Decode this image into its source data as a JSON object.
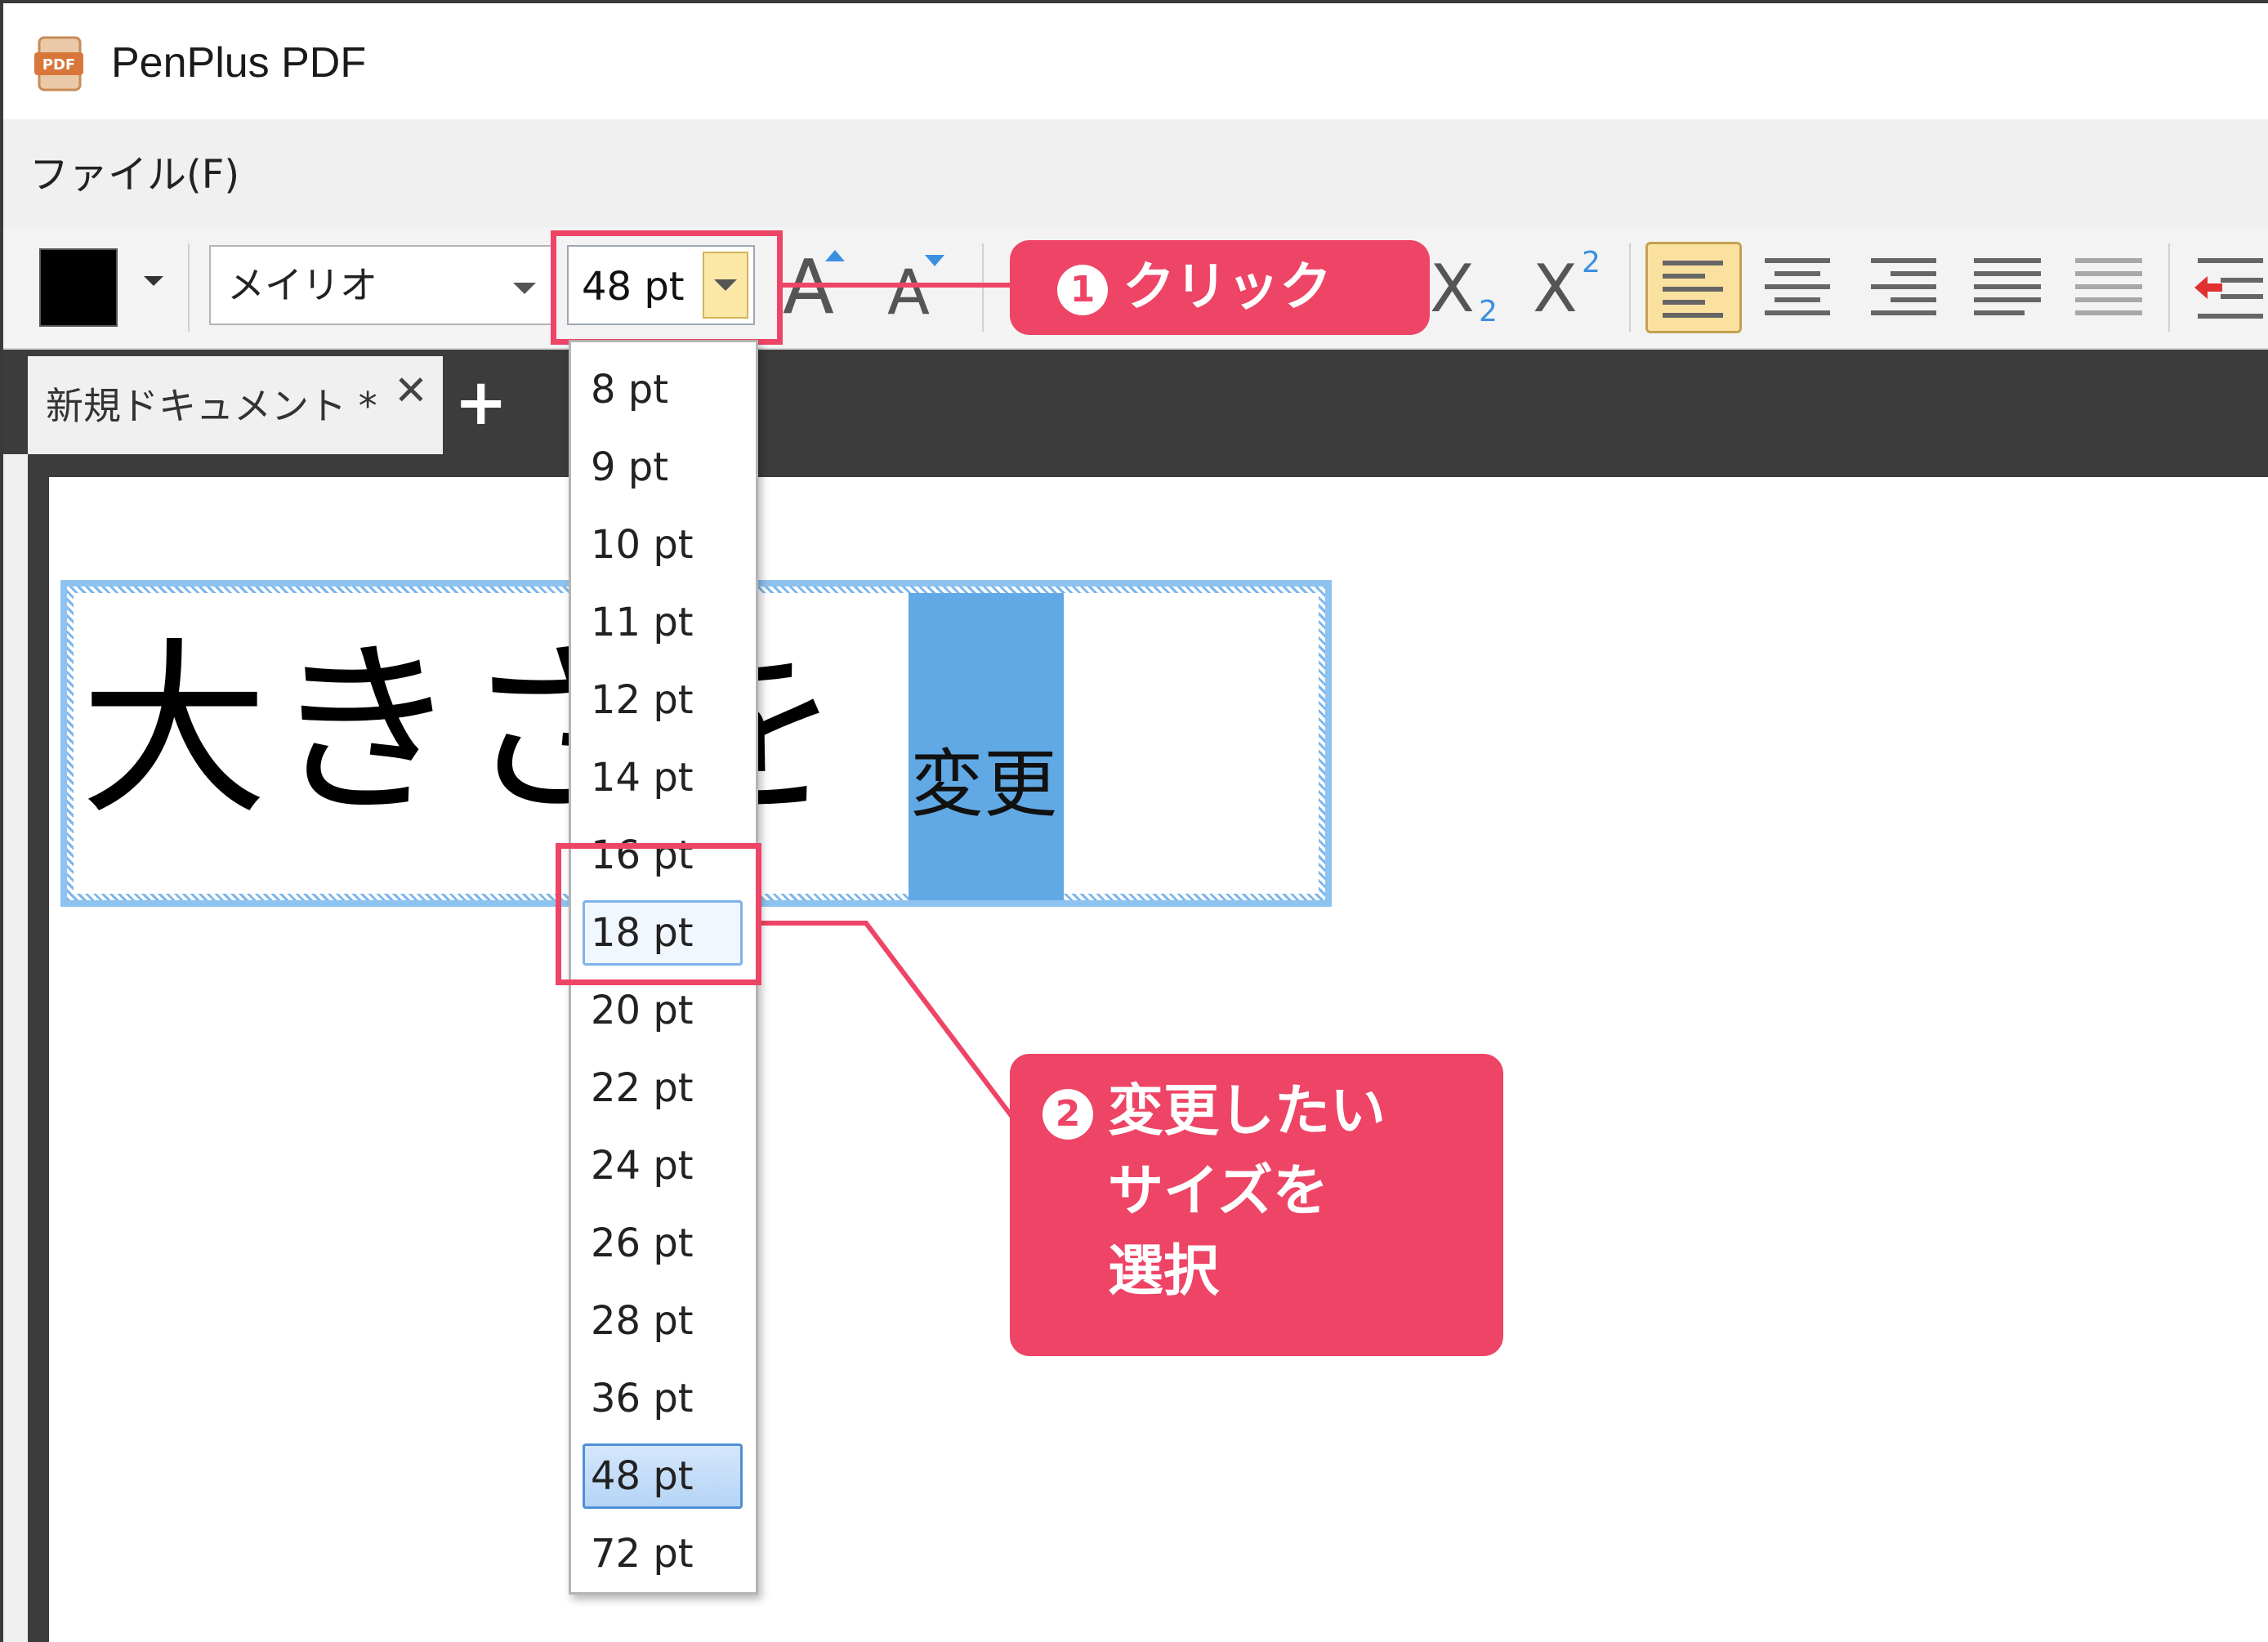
{
  "window": {
    "title": "PenPlus PDF",
    "icon": "pdf-icon",
    "icon_label": "PDF"
  },
  "menu": {
    "file": "ファイル(F)"
  },
  "toolbar": {
    "font_name": "メイリオ",
    "font_size": "48 pt",
    "subscript_label": "X",
    "subscript_digit": "2",
    "superscript_label": "X",
    "superscript_digit": "2",
    "grow_font_label": "A",
    "shrink_font_label": "A"
  },
  "tabs": {
    "active_label": "新規ドキュメント *",
    "close": "✕",
    "add": "+"
  },
  "document": {
    "large_text": "大きさを",
    "selected_text": "変更"
  },
  "size_options": [
    "8 pt",
    "9 pt",
    "10 pt",
    "11 pt",
    "12 pt",
    "14 pt",
    "16 pt",
    "18 pt",
    "20 pt",
    "22 pt",
    "24 pt",
    "26 pt",
    "28 pt",
    "36 pt",
    "48 pt",
    "72 pt"
  ],
  "size_hover": "18 pt",
  "size_selected": "48 pt",
  "callouts": {
    "step1": {
      "number": "1",
      "text": "クリック"
    },
    "step2": {
      "number": "2",
      "lines": [
        "変更したい",
        "サイズを",
        "選択"
      ]
    }
  },
  "colors": {
    "accent": "#ee4466",
    "selection": "#61a9e4",
    "active_button": "#fbe1a0"
  }
}
